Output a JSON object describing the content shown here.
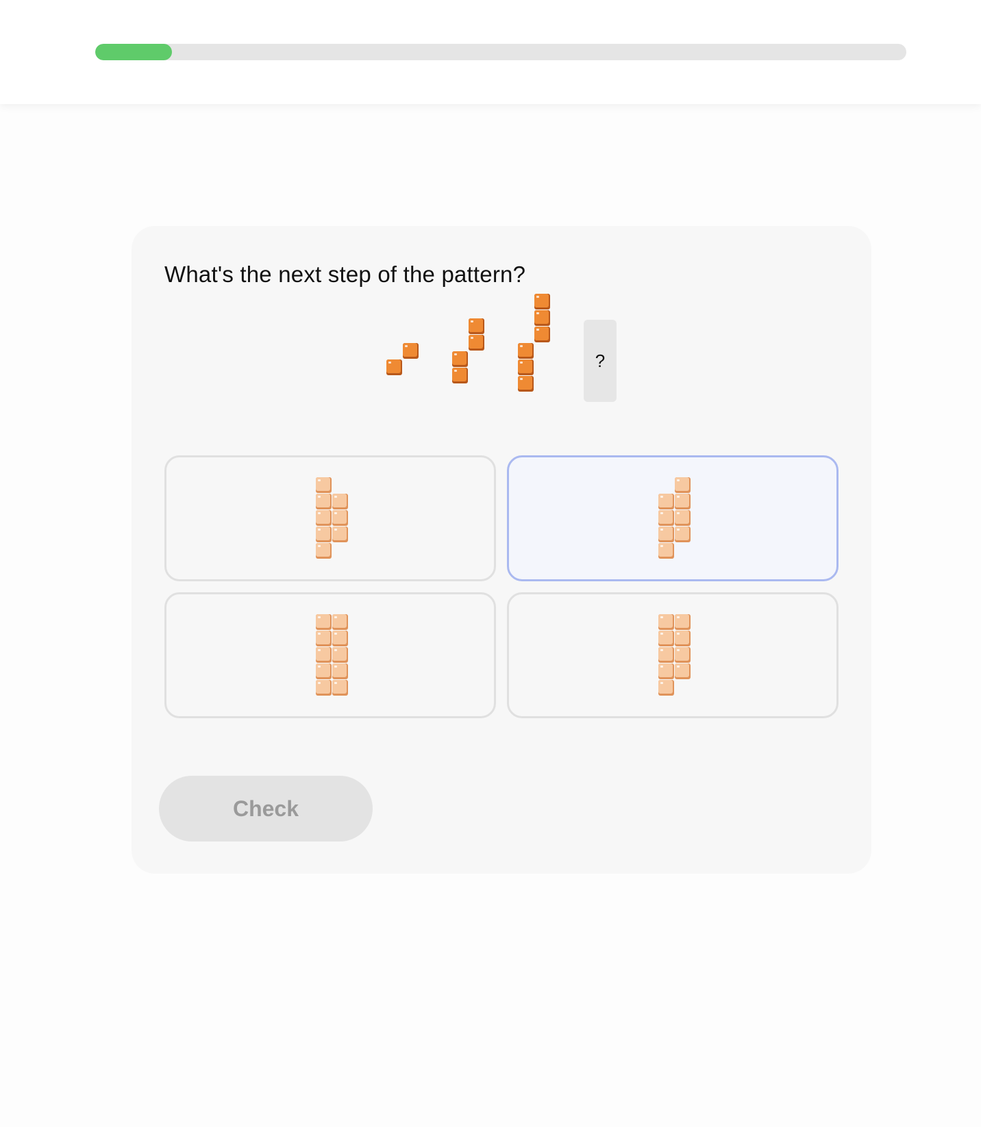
{
  "progress": {
    "fraction": 0.095,
    "color": "#5fcb6a"
  },
  "question": {
    "prompt": "What's the next step of the pattern?",
    "unknown_marker": "?"
  },
  "pattern": {
    "block_color": "#ef8a33",
    "block_dark": "#b8581a",
    "steps": [
      {
        "columns": [
          [
            0
          ],
          [
            1
          ]
        ]
      },
      {
        "columns": [
          [
            0,
            1
          ],
          [
            2,
            3
          ]
        ]
      },
      {
        "columns": [
          [
            0,
            1,
            2
          ],
          [
            3,
            4,
            5
          ]
        ]
      }
    ]
  },
  "options": {
    "block_color": "#f7c9a1",
    "block_dark": "#e0935a",
    "items": [
      {
        "columns": [
          [
            0,
            1,
            2,
            3,
            4
          ],
          [
            1,
            2,
            3
          ]
        ],
        "selected": false
      },
      {
        "columns": [
          [
            0,
            1,
            2,
            3
          ],
          [
            1,
            2,
            3,
            4
          ]
        ],
        "selected": true
      },
      {
        "columns": [
          [
            0,
            1,
            2,
            3,
            4
          ],
          [
            0,
            1,
            2,
            3,
            4
          ]
        ],
        "selected": false
      },
      {
        "columns": [
          [
            0,
            1,
            2,
            3,
            4
          ],
          [
            1,
            2,
            3,
            4
          ]
        ],
        "selected": false
      }
    ]
  },
  "check_button": {
    "label": "Check"
  }
}
